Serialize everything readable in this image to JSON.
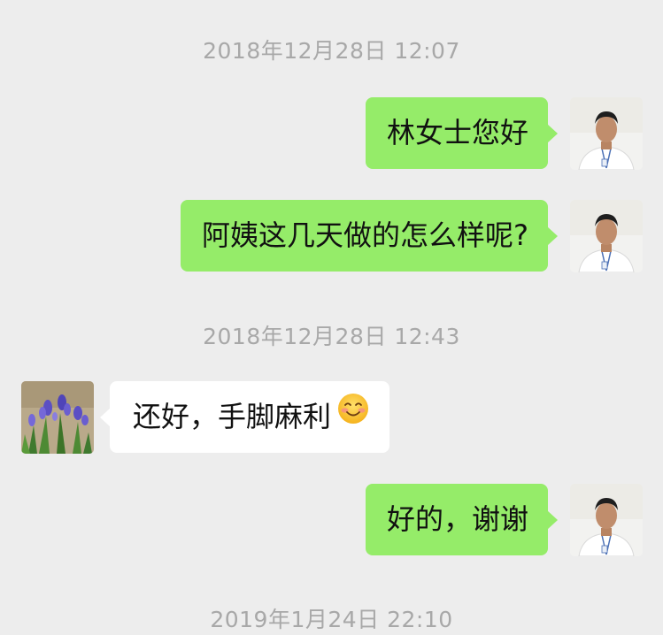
{
  "chat": {
    "timestamps": [
      "2018年12月28日 12:07",
      "2018年12月28日 12:43",
      "2019年1月24日 22:10"
    ],
    "messages": [
      {
        "side": "sent",
        "text": "林女士您好"
      },
      {
        "side": "sent",
        "text": "阿姨这几天做的怎么样呢?"
      },
      {
        "side": "received",
        "text": "还好，手脚麻利",
        "emoji": "smiling-face-with-blush-emoji"
      },
      {
        "side": "sent",
        "text": "好的，谢谢"
      }
    ]
  },
  "colors": {
    "background": "#ededed",
    "sent_bubble": "#95ec69",
    "received_bubble": "#ffffff",
    "timestamp_text": "#a8a8a8"
  },
  "icons": {
    "self_avatar": "user-photo-avatar",
    "contact_avatar": "flower-photo-avatar"
  }
}
